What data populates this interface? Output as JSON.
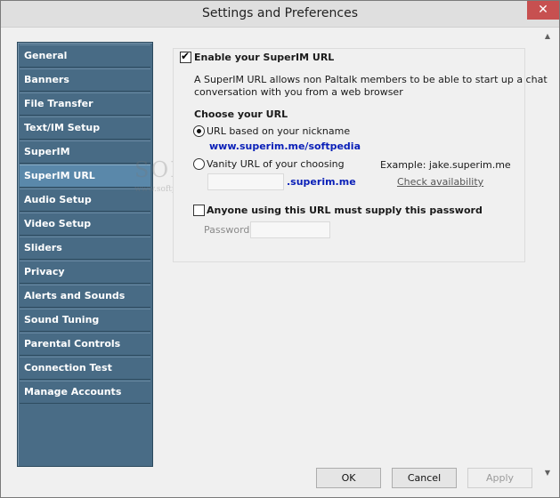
{
  "window": {
    "title": "Settings and Preferences",
    "close_glyph": "✕"
  },
  "sidebar": {
    "items": [
      {
        "label": "General"
      },
      {
        "label": "Banners"
      },
      {
        "label": "File Transfer"
      },
      {
        "label": "Text/IM Setup"
      },
      {
        "label": "SuperIM"
      },
      {
        "label": "SuperIM URL",
        "active": true
      },
      {
        "label": "Audio Setup"
      },
      {
        "label": "Video Setup"
      },
      {
        "label": "Sliders"
      },
      {
        "label": "Privacy"
      },
      {
        "label": "Alerts and Sounds"
      },
      {
        "label": "Sound Tuning"
      },
      {
        "label": "Parental Controls"
      },
      {
        "label": "Connection Test"
      },
      {
        "label": "Manage Accounts"
      }
    ]
  },
  "content": {
    "enable_label": "Enable your SuperIM URL",
    "enable_checked": true,
    "description_line1": "A SuperIM URL allows non Paltalk members to be able to start up a chat",
    "description_line2": "conversation with you from a web browser",
    "choose_heading": "Choose your URL",
    "option_nickname_label": "URL based on your nickname",
    "option_nickname_selected": true,
    "nickname_url": "www.superim.me/softpedia",
    "option_vanity_label": "Vanity URL of your choosing",
    "vanity_example": "Example: jake.superim.me",
    "vanity_value": "",
    "vanity_suffix": ".superim.me",
    "check_availability": "Check availability",
    "password_checkbox_label": "Anyone using this URL must supply this password",
    "password_checked": false,
    "password_label": "Password:",
    "password_value": ""
  },
  "buttons": {
    "ok": "OK",
    "cancel": "Cancel",
    "apply": "Apply"
  },
  "watermark": {
    "text": "SOFTPEDIA",
    "sub": "www.softpedia.com"
  },
  "colors": {
    "sidebar_bg": "#486b85",
    "sidebar_active": "#5a88aa",
    "link_blue": "#0a20b8",
    "close_red": "#c75050"
  }
}
